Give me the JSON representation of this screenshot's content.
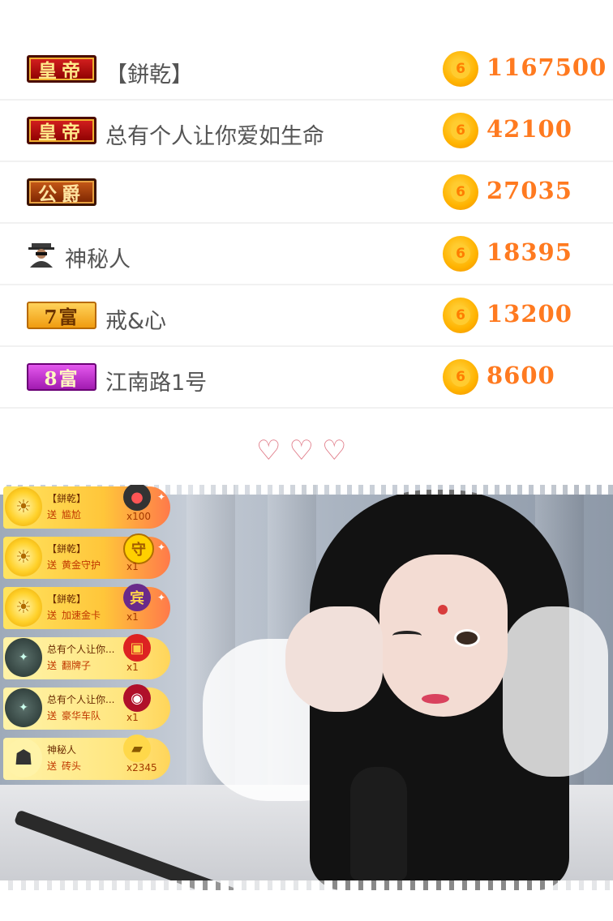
{
  "ranking": [
    {
      "badge": "皇帝",
      "badge_style": "emperor",
      "name": "【鉼乾】",
      "amount": "1167500"
    },
    {
      "badge": "皇帝",
      "badge_style": "emperor",
      "name": "总有个人让你爱如生命",
      "amount": "42100"
    },
    {
      "badge": "公爵",
      "badge_style": "duke",
      "name": "",
      "amount": "27035"
    },
    {
      "badge": "",
      "badge_style": "spy",
      "name": "神秘人",
      "amount": "18395"
    },
    {
      "badge": "7富",
      "badge_style": "rich7",
      "name": "戒&心",
      "amount": "13200"
    },
    {
      "badge": "8富",
      "badge_style": "rich8",
      "name": "江南路1号",
      "amount": "8600"
    }
  ],
  "coin_glyph": "6",
  "hearts": "♡♡♡",
  "gift_feed": [
    {
      "user": "【鉼乾】",
      "send": "送",
      "gift": "尴尬",
      "count": "x100",
      "icon": "bomb-icon",
      "icon_glyph": "●"
    },
    {
      "user": "【鉼乾】",
      "send": "送",
      "gift": "黄金守护",
      "count": "x1",
      "icon": "guard-shield-icon",
      "icon_glyph": "守"
    },
    {
      "user": "【鉼乾】",
      "send": "送",
      "gift": "加速金卡",
      "count": "x1",
      "icon": "gold-card-icon",
      "icon_glyph": "宾"
    },
    {
      "user": "总有个人让你...",
      "send": "送",
      "gift": "翻牌子",
      "count": "x1",
      "icon": "flip-sign-icon",
      "icon_glyph": "▣"
    },
    {
      "user": "总有个人让你...",
      "send": "送",
      "gift": "豪华车队",
      "count": "x1",
      "icon": "car-icon",
      "icon_glyph": "◉"
    },
    {
      "user": "神秘人",
      "send": "送",
      "gift": "砖头",
      "count": "x2345",
      "icon": "brick-icon",
      "icon_glyph": "▰"
    }
  ],
  "colors": {
    "amount": "#ff7a20",
    "coin": "#ffb300",
    "heart": "#e07b88"
  }
}
